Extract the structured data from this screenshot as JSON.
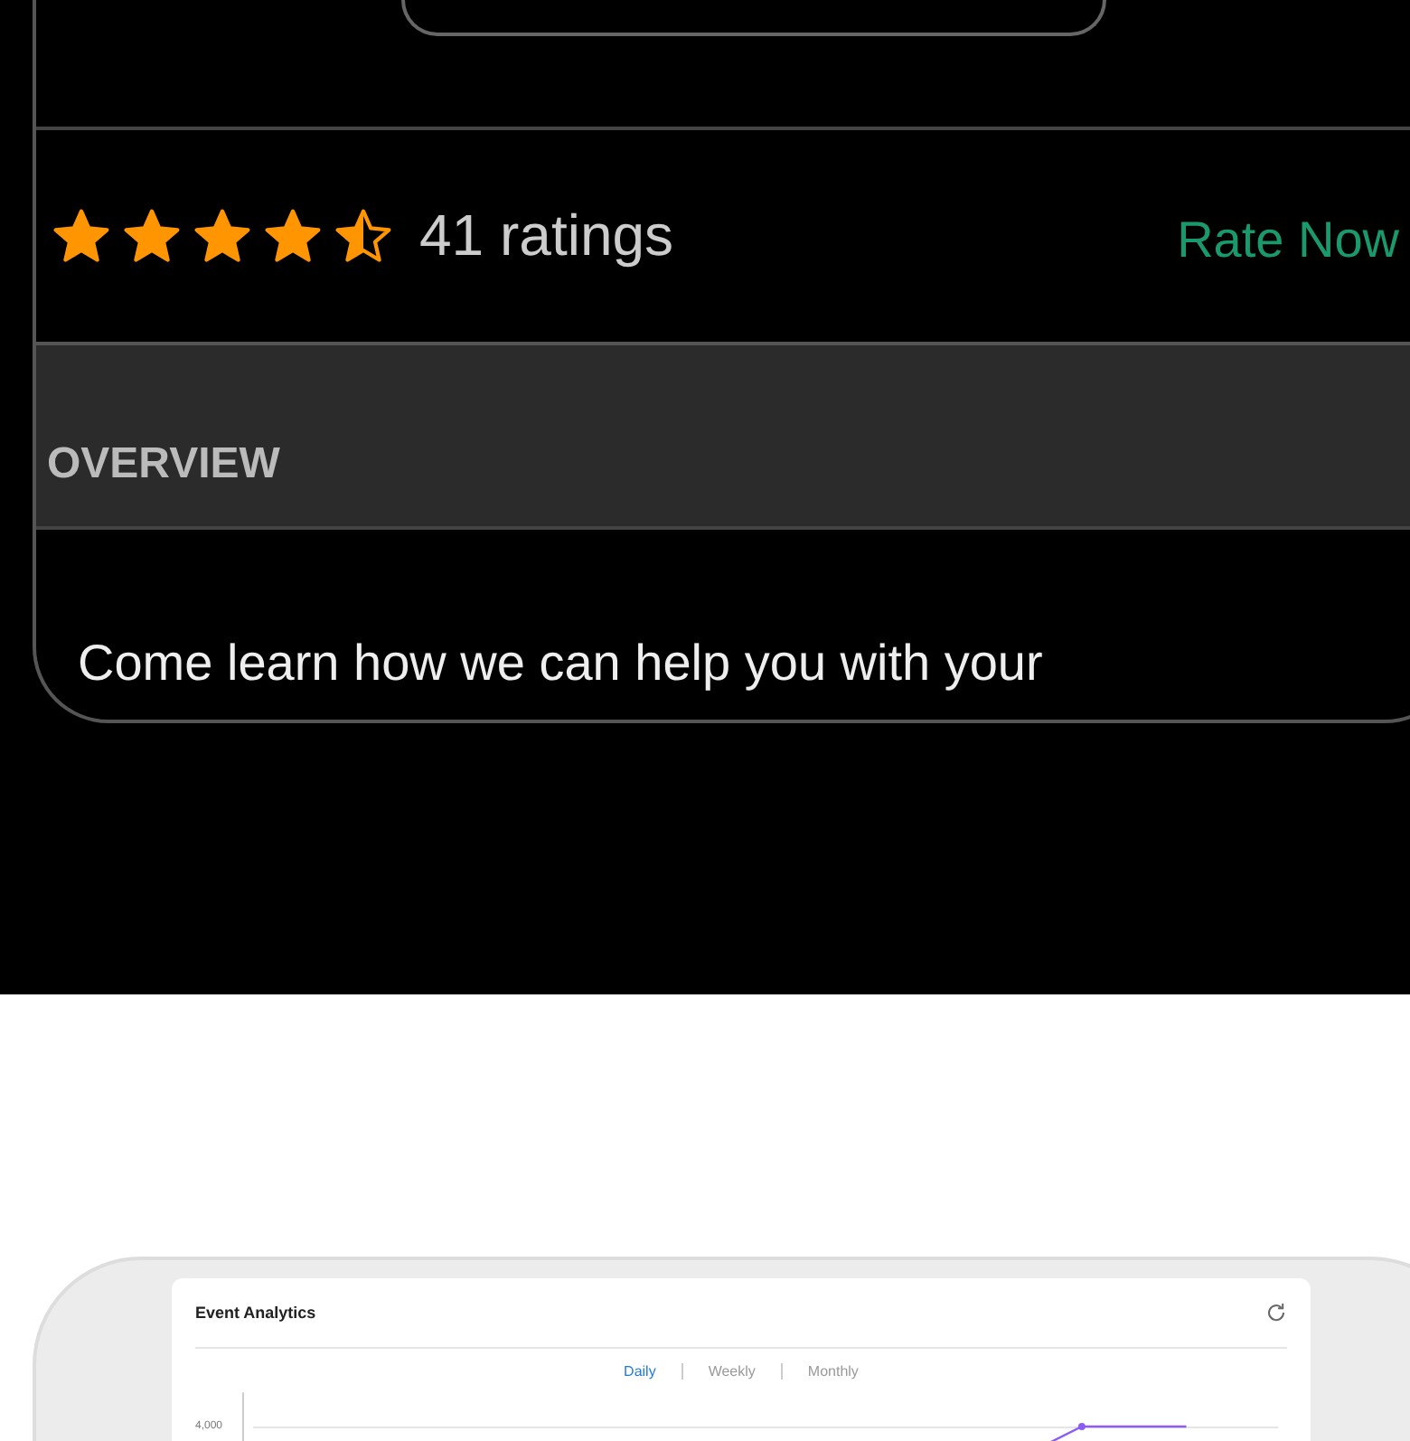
{
  "rating": {
    "stars": 4.5,
    "count_label": "41 ratings",
    "action": "Rate Now"
  },
  "overview": {
    "heading": "OVERVIEW",
    "text": "Come learn how we can help you with your"
  },
  "analytics": {
    "title": "Event Analytics",
    "tabs": [
      {
        "label": "Daily",
        "selected": true
      },
      {
        "label": "Weekly",
        "selected": false
      },
      {
        "label": "Monthly",
        "selected": false
      }
    ],
    "y_tick_label": "4,000"
  }
}
